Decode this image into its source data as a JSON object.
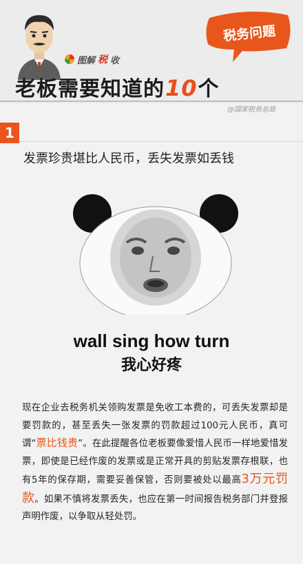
{
  "header": {
    "logo_text": "图解",
    "logo_accent": "税",
    "logo_rest": "收",
    "bubble_text": "税务问题",
    "headline_pre": "老板需要知道的",
    "headline_num": "10",
    "headline_post": "个",
    "source": "@国家税务总局"
  },
  "section": {
    "number": "1",
    "title": "发票珍贵堪比人民币，丢失发票如丢钱"
  },
  "meme": {
    "caption_en": "wall sing how turn",
    "caption_cn": "我心好疼"
  },
  "body": {
    "part1": "现在企业去税务机关领购发票是免收工本费的，可丢失发票却是要罚款的，甚至丢失一张发票的罚款超过100元人民币，真可谓“",
    "highlight1": "票比钱贵",
    "part2": "”。在此提醒各位老板要像爱惜人民币一样地爱惜发票，即使是已经作废的发票或是正常开具的剪贴发票存根联，也有5年的保存期，需要妥善保管，否则要被处以最高",
    "highlight2": "3万元罚款",
    "part3": "。如果不慎将发票丢失，也应在第一时间报告税务部门并登报声明作废，以争取从轻处罚。"
  },
  "colors": {
    "accent": "#e8561c",
    "headline_number": "#e94f1b"
  }
}
